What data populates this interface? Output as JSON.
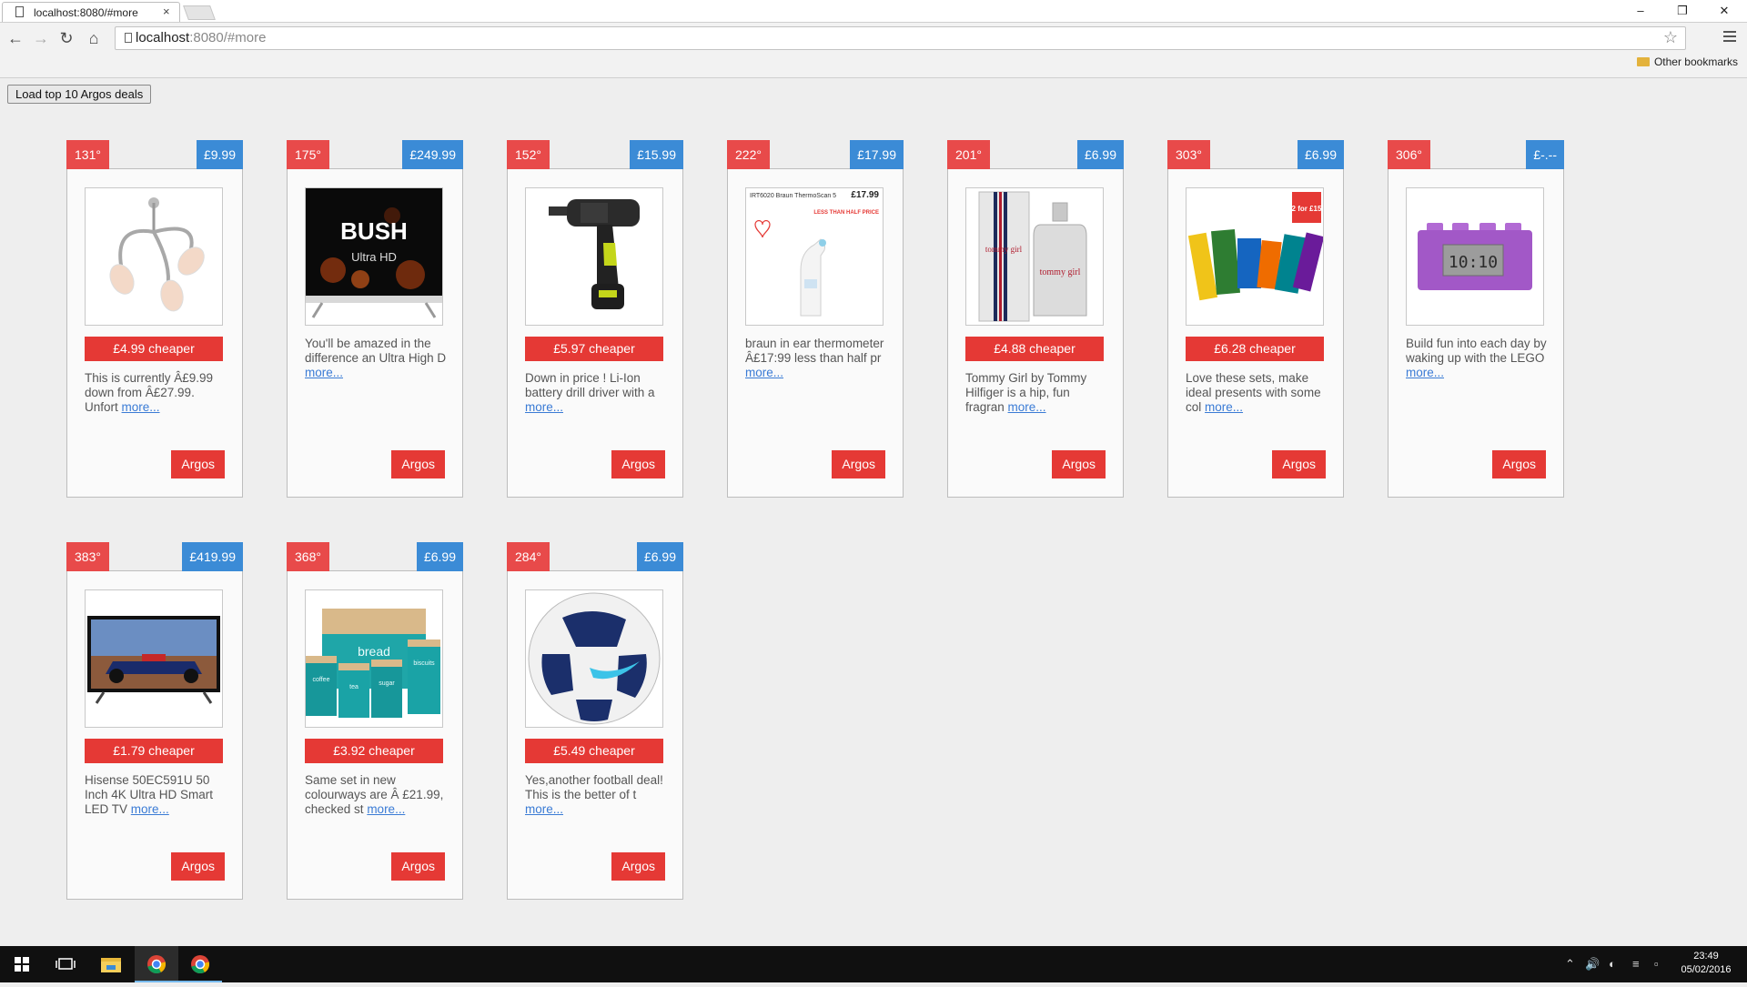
{
  "browser": {
    "tab_title": "localhost:8080/#more",
    "tab_close": "×",
    "url_host": "localhost",
    "url_path": ":8080/#more",
    "bookmarks_label": "Other bookmarks",
    "window_minimize": "–",
    "window_restore": "❐",
    "window_close": "✕"
  },
  "page": {
    "load_button_label": "Load top 10 Argos deals"
  },
  "deals": [
    {
      "temperature": "131°",
      "price": "£9.99",
      "cheaper": "£4.99 cheaper",
      "description": "This is currently Â£9.99 down from Â£27.99. Unfort",
      "more": "more...",
      "merchant": "Argos",
      "image": "ceiling-light-icon"
    },
    {
      "temperature": "175°",
      "price": "£249.99",
      "cheaper": "",
      "description": "You'll be amazed in the difference an Ultra High D",
      "more": "more...",
      "merchant": "Argos",
      "image": "bush-tv-icon",
      "image_text": "BUSH",
      "image_subtext": "Ultra HD"
    },
    {
      "temperature": "152°",
      "price": "£15.99",
      "cheaper": "£5.97 cheaper",
      "description": "Down in price ! Li-Ion battery drill driver with a",
      "more": "more...",
      "merchant": "Argos",
      "image": "drill-icon"
    },
    {
      "temperature": "222°",
      "price": "£17.99",
      "cheaper": "",
      "description": "braun in ear thermometer Â£17:99 less than half pr",
      "more": "more...",
      "merchant": "Argos",
      "image": "thermometer-icon",
      "image_text": "IRT6020 Braun ThermoScan 5",
      "image_price": "£17.99",
      "image_tag": "LESS THAN HALF PRICE"
    },
    {
      "temperature": "201°",
      "price": "£6.99",
      "cheaper": "£4.88 cheaper",
      "description": "Tommy Girl by Tommy Hilfiger is a hip, fun fragran",
      "more": "more...",
      "merchant": "Argos",
      "image": "perfume-icon",
      "image_text": "tommy girl"
    },
    {
      "temperature": "303°",
      "price": "£6.99",
      "cheaper": "£6.28 cheaper",
      "description": "Love these sets, make ideal presents with some col",
      "more": "more...",
      "merchant": "Argos",
      "image": "crayola-sets-icon",
      "image_text": "2 for £15"
    },
    {
      "temperature": "306°",
      "price": "£-.--",
      "cheaper": "",
      "description": "Build fun into each day by waking up with the LEGO",
      "more": "more...",
      "merchant": "Argos",
      "image": "lego-clock-icon",
      "image_text": "10:10"
    },
    {
      "temperature": "383°",
      "price": "£419.99",
      "cheaper": "£1.79 cheaper",
      "description": "Hisense 50EC591U 50 Inch 4K Ultra HD Smart LED TV",
      "more": "more...",
      "merchant": "Argos",
      "image": "hisense-tv-icon"
    },
    {
      "temperature": "368°",
      "price": "£6.99",
      "cheaper": "£3.92 cheaper",
      "description": "Same set in new colourways are Â £21.99, checked st",
      "more": "more...",
      "merchant": "Argos",
      "image": "storage-canisters-icon",
      "image_text": "bread",
      "image_labels": [
        "coffee",
        "tea",
        "sugar",
        "biscuits"
      ]
    },
    {
      "temperature": "284°",
      "price": "£6.99",
      "cheaper": "£5.49 cheaper",
      "description": "Yes,another football deal! This is the better of t",
      "more": "more...",
      "merchant": "Argos",
      "image": "football-icon"
    }
  ],
  "taskbar": {
    "time": "23:49",
    "date": "05/02/2016"
  }
}
